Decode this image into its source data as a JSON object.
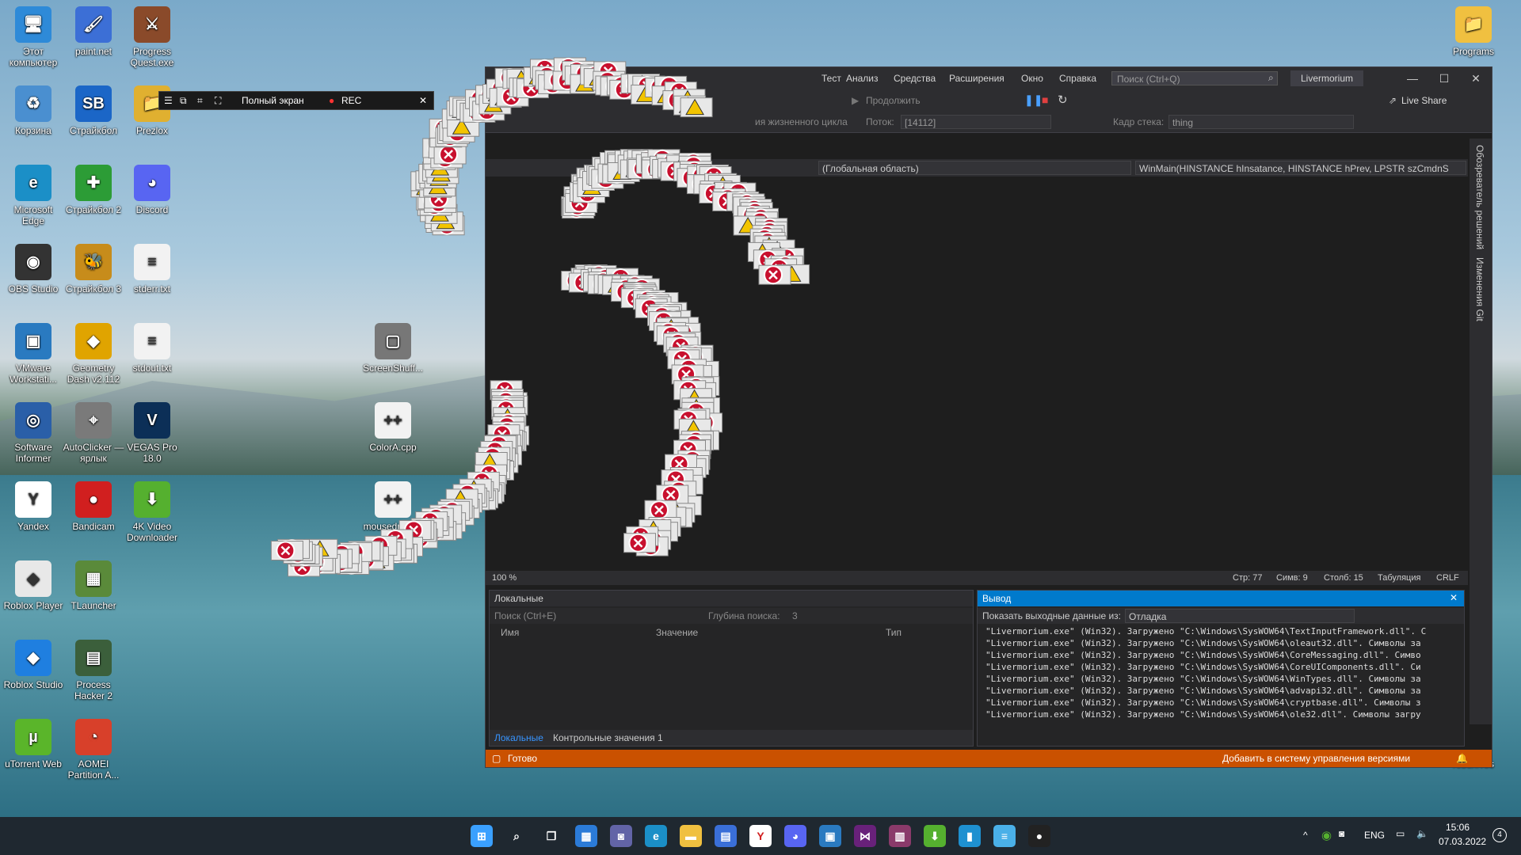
{
  "desktop": {
    "icons": [
      {
        "label": "Этот компьютер",
        "color": "#2e8ad8",
        "glyph": "🖥"
      },
      {
        "label": "paint.net",
        "color": "#3c6fd6",
        "glyph": "🖌"
      },
      {
        "label": "Progress Quest.exe",
        "color": "#8a4a2a",
        "glyph": "⚔"
      },
      {
        "label": "Корзина",
        "color": "#4a8fd0",
        "glyph": "♻"
      },
      {
        "label": "Страйкбол",
        "color": "#1b66c7",
        "glyph": "SB"
      },
      {
        "label": "Prezlox",
        "color": "#e0b030",
        "glyph": "📁"
      },
      {
        "label": "Microsoft Edge",
        "color": "#1b8fc7",
        "glyph": "e"
      },
      {
        "label": "Страйкбол 2",
        "color": "#2c9c36",
        "glyph": "✚"
      },
      {
        "label": "Discord",
        "color": "#5865f2",
        "glyph": "◕"
      },
      {
        "label": "OBS Studio",
        "color": "#333333",
        "glyph": "◉"
      },
      {
        "label": "Страйкбол 3",
        "color": "#c78c1b",
        "glyph": "🐝"
      },
      {
        "label": "stderr.txt",
        "color": "#f2f2f2",
        "glyph": "≡"
      },
      {
        "label": "VMware Workstati...",
        "color": "#2a7ac0",
        "glyph": "▣"
      },
      {
        "label": "Geometry Dash v2.112",
        "color": "#e0a400",
        "glyph": "◆"
      },
      {
        "label": "stdout.txt",
        "color": "#f2f2f2",
        "glyph": "≡"
      },
      {
        "label": "Software Informer",
        "color": "#2a5fa8",
        "glyph": "◎"
      },
      {
        "label": "AutoClicker — ярлык",
        "color": "#7a7a7a",
        "glyph": "⌖"
      },
      {
        "label": "VEGAS Pro 18.0",
        "color": "#0c2f57",
        "glyph": "V"
      },
      {
        "label": "Yandex",
        "color": "#ffffff",
        "glyph": "Y"
      },
      {
        "label": "Bandicam",
        "color": "#d11f1f",
        "glyph": "●"
      },
      {
        "label": "4K Video Downloader",
        "color": "#55b02f",
        "glyph": "⬇"
      },
      {
        "label": "Roblox Player",
        "color": "#e8e8e8",
        "glyph": "◆"
      },
      {
        "label": "TLauncher",
        "color": "#5a8a3a",
        "glyph": "▦"
      },
      {
        "label": "Roblox Studio",
        "color": "#1f7fe0",
        "glyph": "◆"
      },
      {
        "label": "Process Hacker 2",
        "color": "#3b5f3b",
        "glyph": "▤"
      },
      {
        "label": "uTorrent Web",
        "color": "#5ab52a",
        "glyph": "µ"
      },
      {
        "label": "AOMEI Partition A...",
        "color": "#d8402a",
        "glyph": "◔"
      },
      {
        "label": "ScreenShuff...",
        "color": "#777777",
        "glyph": "▢"
      },
      {
        "label": "ColorA.cpp",
        "color": "#f2f2f2",
        "glyph": "++"
      },
      {
        "label": "mousedraw....",
        "color": "#f2f2f2",
        "glyph": "++"
      },
      {
        "label": "Programs",
        "color": "#f0c040",
        "glyph": "📁"
      },
      {
        "label": "robux.vbs",
        "color": "#cccccc",
        "glyph": "▤"
      }
    ]
  },
  "recorder": {
    "mode_label": "Полный экран",
    "rec_label": "REC"
  },
  "vs": {
    "menu": [
      "Тест",
      "Анализ",
      "Средства",
      "Расширения",
      "Окно",
      "Справка"
    ],
    "search_placeholder": "Поиск (Ctrl+Q)",
    "project_name": "Livermorium",
    "live_share": "Live Share",
    "toolbar": {
      "continue_label": "Продолжить",
      "lifecycle_label": "ия жизненного цикла",
      "thread_label": "Поток:",
      "thread_value": "[14112]",
      "stack_frame_label": "Кадр стека:",
      "stack_frame_value": "thing"
    },
    "navbar": {
      "scope": "(Глобальная область)",
      "function": "WinMain(HINSTANCE hInsatance, HINSTANCE hPrev, LPSTR szCmdnS"
    },
    "editor_status": {
      "zoom": "100 %",
      "line": "Стр: 77",
      "char": "Симв: 9",
      "col": "Столб: 15",
      "tabs": "Табуляция",
      "eol": "CRLF"
    },
    "right_rail": [
      "Обозреватель решений",
      "Изменения Git"
    ],
    "locals": {
      "title": "Локальные",
      "search_placeholder": "Поиск (Ctrl+E)",
      "depth_label": "Глубина поиска:",
      "depth_value": "3",
      "columns": [
        "Имя",
        "Значение",
        "Тип"
      ],
      "tabs": [
        "Локальные",
        "Контрольные значения 1"
      ]
    },
    "output": {
      "title": "Вывод",
      "show_from_label": "Показать выходные данные из:",
      "show_from_value": "Отладка",
      "lines": [
        "\"Livermorium.exe\" (Win32). Загружено \"C:\\Windows\\SysWOW64\\TextInputFramework.dll\". С",
        "\"Livermorium.exe\" (Win32). Загружено \"C:\\Windows\\SysWOW64\\oleaut32.dll\". Символы за",
        "\"Livermorium.exe\" (Win32). Загружено \"C:\\Windows\\SysWOW64\\CoreMessaging.dll\". Симво",
        "\"Livermorium.exe\" (Win32). Загружено \"C:\\Windows\\SysWOW64\\CoreUIComponents.dll\". Си",
        "\"Livermorium.exe\" (Win32). Загружено \"C:\\Windows\\SysWOW64\\WinTypes.dll\". Символы за",
        "\"Livermorium.exe\" (Win32). Загружено \"C:\\Windows\\SysWOW64\\advapi32.dll\". Символы за",
        "\"Livermorium.exe\" (Win32). Загружено \"C:\\Windows\\SysWOW64\\cryptbase.dll\". Символы з",
        "\"Livermorium.exe\" (Win32). Загружено \"C:\\Windows\\SysWOW64\\ole32.dll\". Символы загру"
      ]
    },
    "statusbar": {
      "ready": "Готово",
      "vcs": "Добавить в систему управления версиями"
    }
  },
  "taskbar": {
    "icons": [
      {
        "name": "start-icon",
        "color": "#3aa0ff",
        "glyph": "⊞"
      },
      {
        "name": "search-icon",
        "color": "transparent",
        "glyph": "⌕"
      },
      {
        "name": "task-view-icon",
        "color": "transparent",
        "glyph": "❐"
      },
      {
        "name": "widgets-icon",
        "color": "#2b7bd8",
        "glyph": "▦"
      },
      {
        "name": "chat-icon",
        "color": "#6264a7",
        "glyph": "◙"
      },
      {
        "name": "edge-icon",
        "color": "#1b8fc7",
        "glyph": "e"
      },
      {
        "name": "explorer-icon",
        "color": "#f0c040",
        "glyph": "▬"
      },
      {
        "name": "store-icon",
        "color": "#3a6fd8",
        "glyph": "▤"
      },
      {
        "name": "yandex-icon",
        "color": "#ffffff",
        "glyph": "Y"
      },
      {
        "name": "discord-icon",
        "color": "#5865f2",
        "glyph": "◕"
      },
      {
        "name": "vmware-icon",
        "color": "#2a7ac0",
        "glyph": "▣"
      },
      {
        "name": "visual-studio-icon",
        "color": "#68217a",
        "glyph": "⋈"
      },
      {
        "name": "winrar-icon",
        "color": "#8a3a6a",
        "glyph": "▥"
      },
      {
        "name": "4k-downloader-icon",
        "color": "#55b02f",
        "glyph": "⬇"
      },
      {
        "name": "app-badge-icon",
        "color": "#1e90d0",
        "glyph": "▮"
      },
      {
        "name": "notepad-icon",
        "color": "#4ab0e8",
        "glyph": "≡"
      },
      {
        "name": "record-icon",
        "color": "#222222",
        "glyph": "●"
      }
    ],
    "tray": {
      "language": "ENG",
      "time": "15:06",
      "date": "07.03.2022",
      "notifications": "4"
    }
  }
}
